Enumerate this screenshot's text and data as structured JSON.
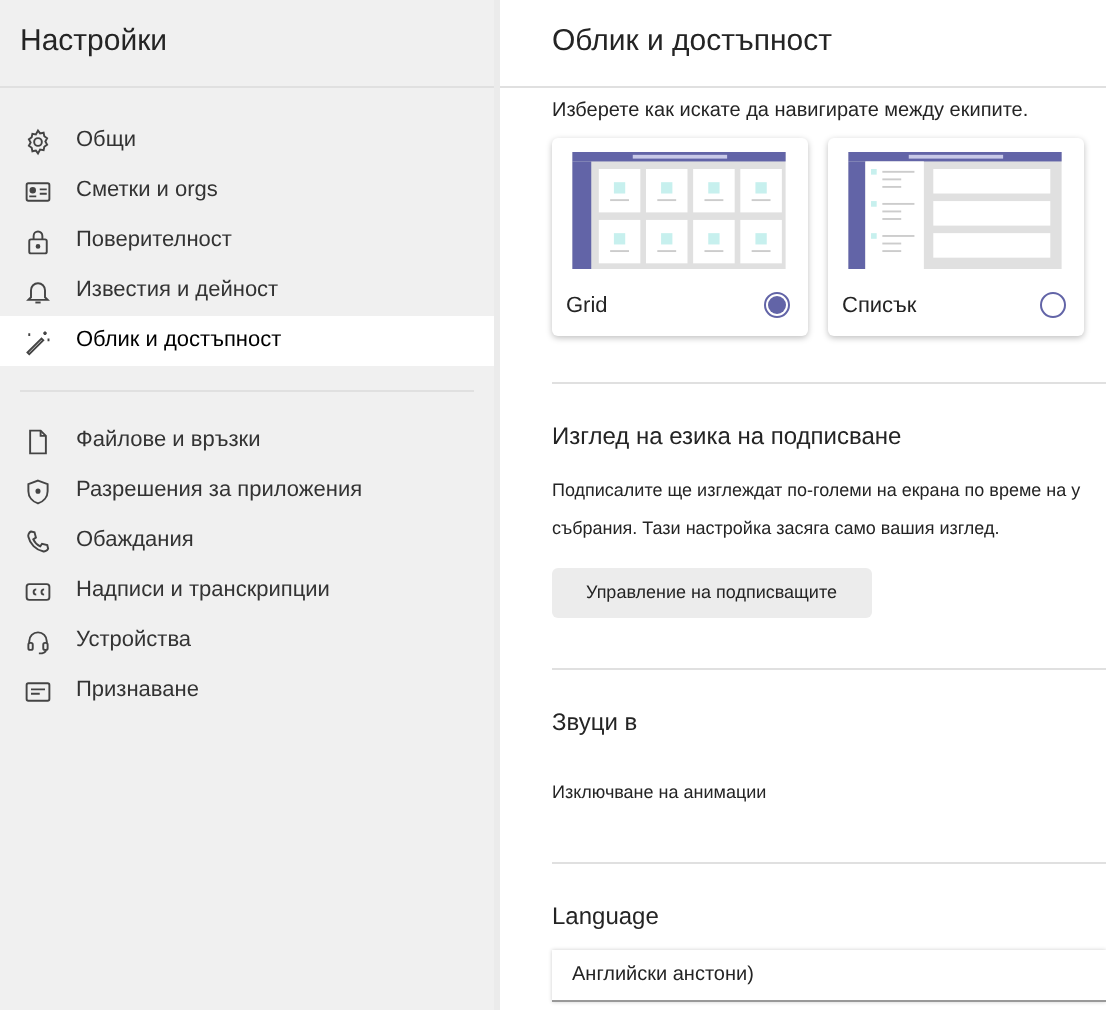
{
  "sidebar": {
    "title": "Настройки",
    "groups": [
      {
        "items": [
          {
            "label": "Общи",
            "selected": false
          },
          {
            "label": "Сметки и orgs",
            "selected": false
          },
          {
            "label": "Поверителност",
            "selected": false
          },
          {
            "label": "Известия и дейност",
            "selected": false
          },
          {
            "label": "Облик и достъпност",
            "selected": true
          }
        ]
      },
      {
        "items": [
          {
            "label": "Файлове и връзки",
            "selected": false
          },
          {
            "label": "Разрешения за приложения",
            "selected": false
          },
          {
            "label": "Обаждания",
            "selected": false
          },
          {
            "label": "Надписи и транскрипции",
            "selected": false
          },
          {
            "label": "Устройства",
            "selected": false
          },
          {
            "label": "Признаване",
            "selected": false
          }
        ]
      }
    ]
  },
  "main": {
    "title": "Облик и достъпност",
    "layout": {
      "prompt": "Изберете как искате да навигирате между екипите.",
      "options": [
        {
          "kind": "grid",
          "label": "Grid",
          "selected": true
        },
        {
          "kind": "list",
          "label": "Списък",
          "selected": false
        }
      ]
    },
    "captions": {
      "heading": "Изглед на езика на подписване",
      "lines": [
        "Подписалите ще изглеждат по-големи на екрана по време на у",
        "събрания. Тази настройка засяга само вашия изглед."
      ],
      "button": "Управление на подписващите"
    },
    "sounds": {
      "heading": "Звуци в",
      "text": "Изключване на анимации"
    },
    "language": {
      "heading": "Language",
      "value": "Английски анстони)"
    }
  }
}
